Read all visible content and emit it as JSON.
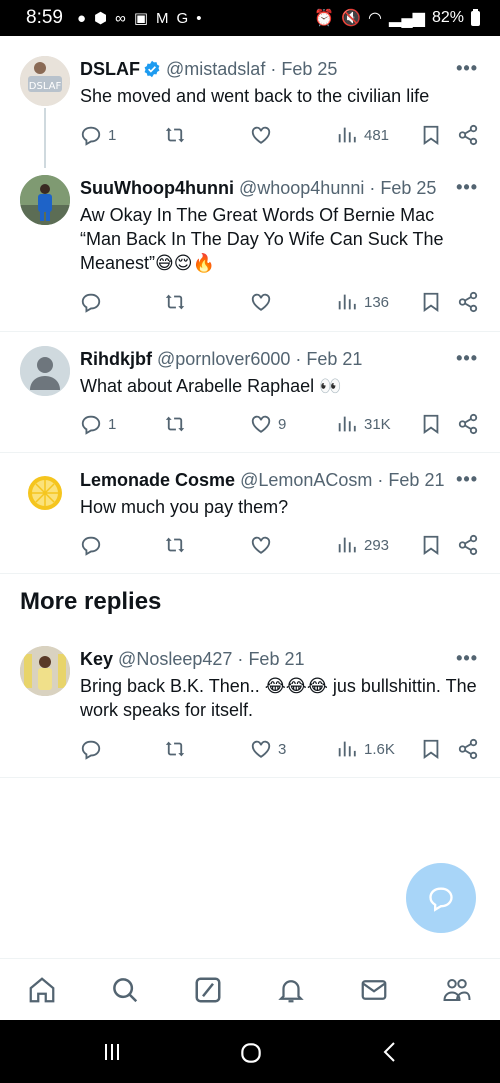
{
  "status_bar": {
    "time": "8:59",
    "battery": "82%"
  },
  "tweets": [
    {
      "name": "DSLAF",
      "verified": true,
      "handle": "@mistadslaf",
      "date": "Feb 25",
      "text": "She moved and went back to the civilian life",
      "replies": "1",
      "retweets": "",
      "likes": "",
      "views": "481"
    },
    {
      "name": "SuuWhoop4hunni",
      "handle": "@whoop4hunni",
      "date": "Feb 25",
      "text": "Aw Okay In The Great Words Of Bernie Mac “Man Back In The Day Yo Wife Can Suck The Meanest”😅😌🔥",
      "replies": "",
      "retweets": "",
      "likes": "",
      "views": "136"
    },
    {
      "name": "Rihdkjbf",
      "handle": "@pornlover6000",
      "date": "Feb 21",
      "text": "What about Arabelle Raphael 👀",
      "replies": "1",
      "retweets": "",
      "likes": "9",
      "views": "31K"
    },
    {
      "name": "Lemonade Cosme",
      "handle": "@LemonACosm",
      "date": "Feb 21",
      "text": "How much you pay them?",
      "replies": "",
      "retweets": "",
      "likes": "",
      "views": "293"
    },
    {
      "name": "Key",
      "handle": "@Nosleep427",
      "date": "Feb 21",
      "text": "Bring back B.K. Then.. 😂😂😂 jus bullshittin. The work speaks for itself.",
      "replies": "",
      "retweets": "",
      "likes": "3",
      "views": "1.6K"
    }
  ],
  "section": {
    "more_replies": "More replies"
  },
  "icons": {
    "reply": "reply-icon",
    "retweet": "retweet-icon",
    "like": "heart-icon",
    "views": "views-icon",
    "bookmark": "bookmark-icon",
    "share": "share-icon",
    "more": "more-icon"
  },
  "colors": {
    "accent": "#1d9bf0",
    "fab": "#a8d5f8",
    "secondary_text": "#536471"
  }
}
